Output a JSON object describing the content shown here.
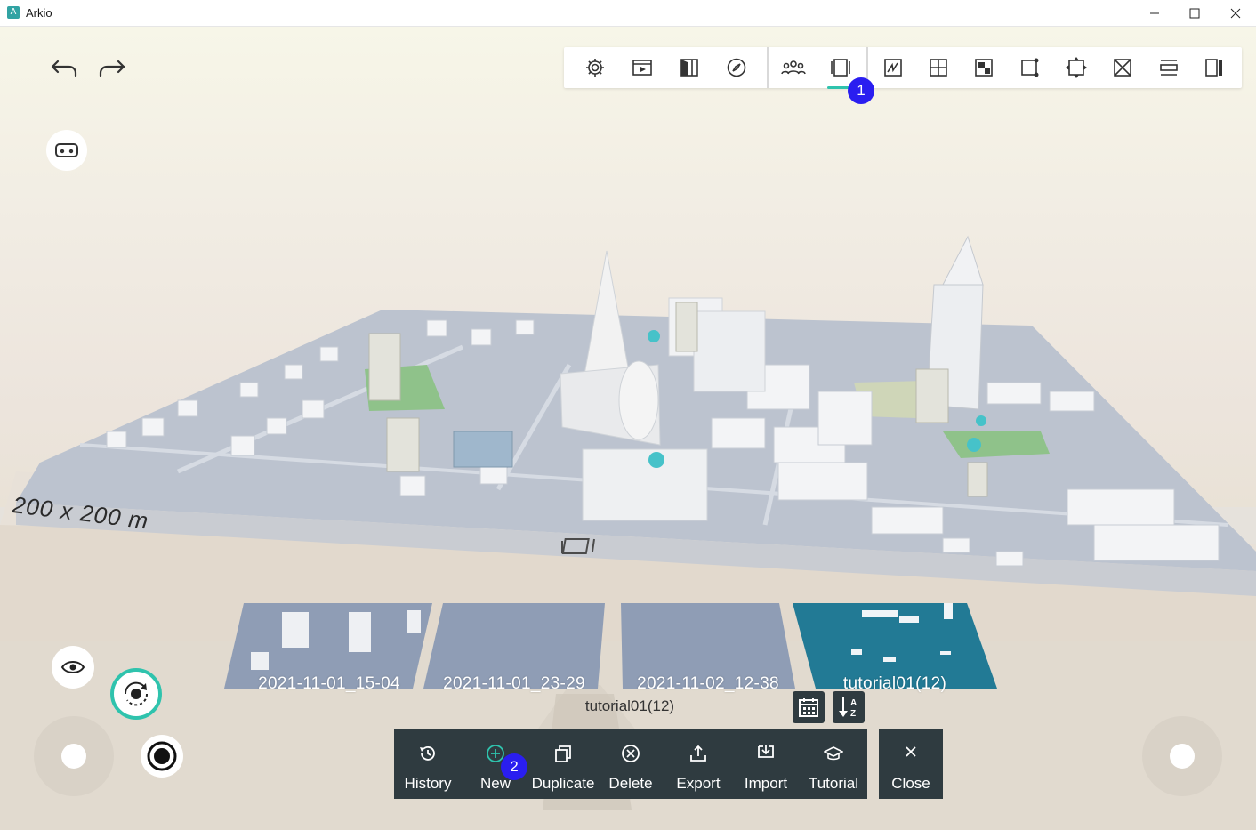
{
  "window": {
    "title": "Arkio",
    "app_icon_glyph": "A",
    "controls": [
      "minimize-icon",
      "maximize-icon",
      "close-icon"
    ]
  },
  "toolbar": {
    "icons": [
      "settings-icon",
      "presentation-icon",
      "split-view-icon",
      "compass-icon",
      "collaborators-icon",
      "model-boards-icon",
      "sketch-icon",
      "grid-icon",
      "checker-icon",
      "resize-icon",
      "select-area-icon",
      "crossed-box-icon",
      "section-icon",
      "side-panel-icon"
    ],
    "active": "model-boards-icon"
  },
  "badges": {
    "one": "1",
    "two": "2"
  },
  "scene": {
    "scale_label": "200 x 200 m",
    "board_symbol": "model-board-icon"
  },
  "thumbnails": [
    {
      "label": "2021-11-01_15-04",
      "selected": false
    },
    {
      "label": "2021-11-01_23-29",
      "selected": false
    },
    {
      "label": "2021-11-02_12-38",
      "selected": false
    },
    {
      "label": "tutorial01(12)",
      "selected": true
    }
  ],
  "current_model": "tutorial01(12)",
  "sort_icons": [
    "calendar-sort-icon",
    "alpha-sort-icon"
  ],
  "menu": {
    "history": "History",
    "new": "New",
    "duplicate": "Duplicate",
    "delete": "Delete",
    "export": "Export",
    "import": "Import",
    "tutorial": "Tutorial",
    "close": "Close"
  },
  "colors": {
    "accent": "#2fc3ad",
    "selected_board": "#227a95",
    "bar": "#2f3b40",
    "badge": "#2a1ef0"
  }
}
